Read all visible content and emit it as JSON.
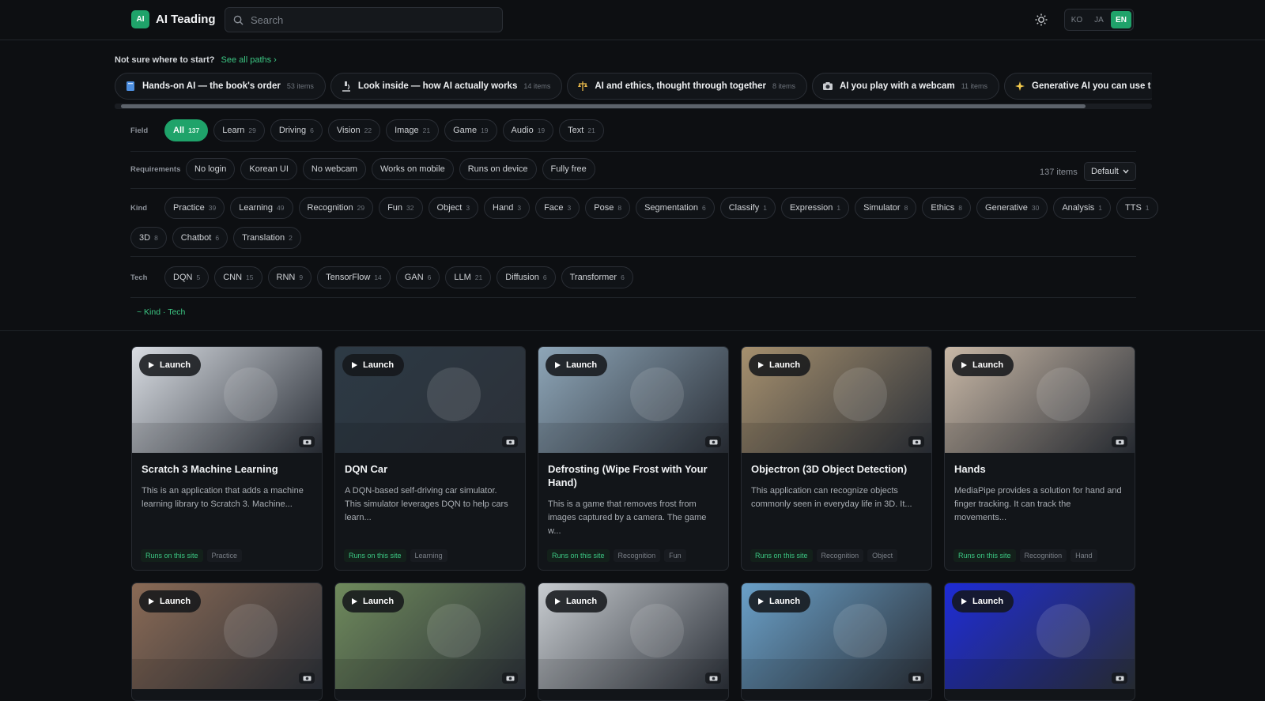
{
  "app": {
    "logo_badge": "AI",
    "title": "AI Teading"
  },
  "search": {
    "placeholder": "Search"
  },
  "languages": [
    {
      "label": "KO"
    },
    {
      "label": "JA"
    },
    {
      "label": "EN",
      "active": true
    }
  ],
  "paths": {
    "prompt": "Not sure where to start?",
    "see_all": "See all paths ›",
    "items": [
      {
        "icon": "book-icon",
        "title": "Hands-on AI — the book's order",
        "count": "53 items"
      },
      {
        "icon": "microscope-icon",
        "title": "Look inside — how AI actually works",
        "count": "14 items"
      },
      {
        "icon": "scales-icon",
        "title": "AI and ethics, thought through together",
        "count": "8 items"
      },
      {
        "icon": "camera-icon",
        "title": "AI you play with a webcam",
        "count": "11 items"
      },
      {
        "icon": "sparkle-icon",
        "title": "Generative AI you can use t",
        "count": ""
      }
    ]
  },
  "filters": {
    "field": {
      "label": "Field",
      "chips": [
        {
          "label": "All",
          "count": "137",
          "active": true
        },
        {
          "label": "Learn",
          "count": "29"
        },
        {
          "label": "Driving",
          "count": "6"
        },
        {
          "label": "Vision",
          "count": "22"
        },
        {
          "label": "Image",
          "count": "21"
        },
        {
          "label": "Game",
          "count": "19"
        },
        {
          "label": "Audio",
          "count": "19"
        },
        {
          "label": "Text",
          "count": "21"
        }
      ]
    },
    "requirements": {
      "label": "Requirements",
      "chips": [
        {
          "label": "No login"
        },
        {
          "label": "Korean UI"
        },
        {
          "label": "No webcam"
        },
        {
          "label": "Works on mobile"
        },
        {
          "label": "Runs on device"
        },
        {
          "label": "Fully free"
        }
      ]
    },
    "kind": {
      "label": "Kind",
      "chips": [
        {
          "label": "Practice",
          "count": "39"
        },
        {
          "label": "Learning",
          "count": "49"
        },
        {
          "label": "Recognition",
          "count": "29"
        },
        {
          "label": "Fun",
          "count": "32"
        },
        {
          "label": "Object",
          "count": "3"
        },
        {
          "label": "Hand",
          "count": "3"
        },
        {
          "label": "Face",
          "count": "3"
        },
        {
          "label": "Pose",
          "count": "8"
        },
        {
          "label": "Segmentation",
          "count": "6"
        },
        {
          "label": "Classify",
          "count": "1"
        },
        {
          "label": "Expression",
          "count": "1"
        },
        {
          "label": "Simulator",
          "count": "8"
        },
        {
          "label": "Ethics",
          "count": "8"
        },
        {
          "label": "Generative",
          "count": "30"
        },
        {
          "label": "Analysis",
          "count": "1"
        },
        {
          "label": "TTS",
          "count": "1"
        },
        {
          "label": "3D",
          "count": "8"
        },
        {
          "label": "Chatbot",
          "count": "6"
        },
        {
          "label": "Translation",
          "count": "2"
        }
      ]
    },
    "tech": {
      "label": "Tech",
      "chips": [
        {
          "label": "DQN",
          "count": "5"
        },
        {
          "label": "CNN",
          "count": "15"
        },
        {
          "label": "RNN",
          "count": "9"
        },
        {
          "label": "TensorFlow",
          "count": "14"
        },
        {
          "label": "GAN",
          "count": "6"
        },
        {
          "label": "LLM",
          "count": "21"
        },
        {
          "label": "Diffusion",
          "count": "6"
        },
        {
          "label": "Transformer",
          "count": "6"
        }
      ]
    },
    "collapse_link": "~ Kind · Tech",
    "item_count": "137 items",
    "sort": "Default"
  },
  "launch_label": "Launch",
  "cards": [
    {
      "title": "Scratch 3 Machine Learning",
      "desc": "This is an application that adds a machine learning library to Scratch 3. Machine...",
      "tags": [
        "Runs on this site",
        "Practice"
      ],
      "theme": "#d9dde3"
    },
    {
      "title": "DQN Car",
      "desc": "A DQN-based self-driving car simulator. This simulator leverages DQN to help cars learn...",
      "tags": [
        "Runs on this site",
        "Learning"
      ],
      "theme": "#2d3a45"
    },
    {
      "title": "Defrosting (Wipe Frost with Your Hand)",
      "desc": "This is a game that removes frost from images captured by a camera. The game w...",
      "tags": [
        "Runs on this site",
        "Recognition",
        "Fun"
      ],
      "theme": "#8ea6b8"
    },
    {
      "title": "Objectron (3D Object Detection)",
      "desc": "This application can recognize objects commonly seen in everyday life in 3D. It...",
      "tags": [
        "Runs on this site",
        "Recognition",
        "Object"
      ],
      "theme": "#a6906e"
    },
    {
      "title": "Hands",
      "desc": "MediaPipe provides a solution for hand and finger tracking. It can track the movements...",
      "tags": [
        "Runs on this site",
        "Recognition",
        "Hand"
      ],
      "theme": "#c9b8a6"
    },
    {
      "title": "",
      "desc": "",
      "tags": [],
      "theme": "#8a6a55"
    },
    {
      "title": "",
      "desc": "",
      "tags": [],
      "theme": "#6f8a5c"
    },
    {
      "title": "",
      "desc": "",
      "tags": [],
      "theme": "#c8ccd0"
    },
    {
      "title": "",
      "desc": "",
      "tags": [],
      "theme": "#6aa0c8"
    },
    {
      "title": "",
      "desc": "",
      "tags": [],
      "theme": "#1d2bd6"
    }
  ],
  "colors": {
    "accent": "#1fa36a",
    "background": "#0d0f12"
  }
}
